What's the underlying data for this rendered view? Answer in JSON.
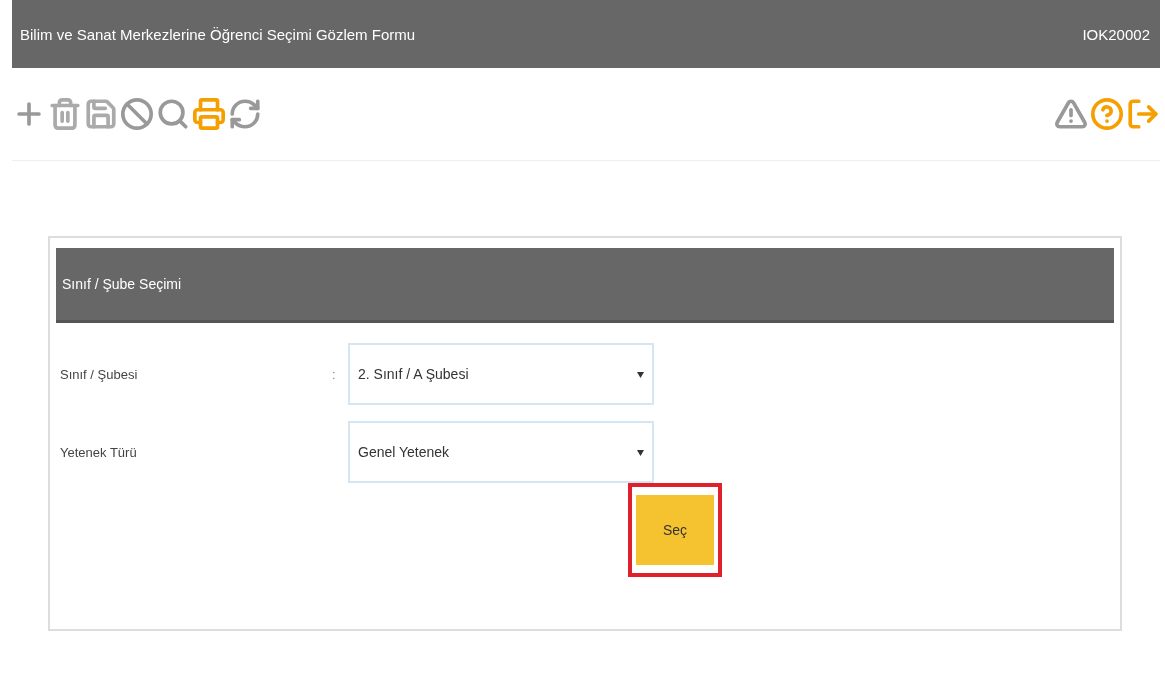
{
  "window": {
    "title": "Bilim ve Sanat Merkezlerine Öğrenci Seçimi Gözlem Formu",
    "code": "IOK20002"
  },
  "panel": {
    "title": "Sınıf / Şube Seçimi",
    "fields": [
      {
        "label": "Sınıf / Şubesi",
        "separator": ":",
        "value": "2. Sınıf / A Şubesi"
      },
      {
        "label": "Yetenek Türü",
        "value": "Genel Yetenek"
      }
    ],
    "button": {
      "label": "Seç",
      "highlighted": true
    }
  }
}
